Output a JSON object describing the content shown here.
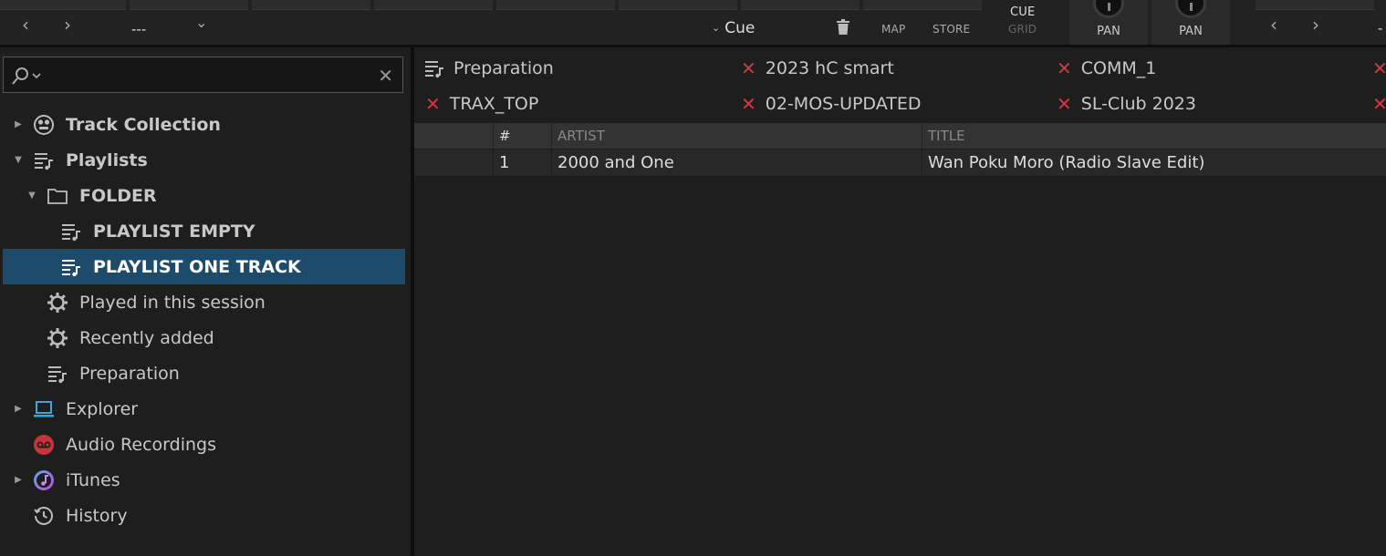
{
  "topbar": {
    "nav_prev": "‹",
    "nav_next": "›",
    "selector_value": "---",
    "selector_chevron": "⌄",
    "cue_chevron": "⌄",
    "cue_label": "Cue",
    "map_label": "MAP",
    "store_label": "STORE",
    "cue_grid_top": "CUE",
    "cue_grid_bottom": "GRID",
    "pan_left_label": "PAN",
    "pan_right_label": "PAN",
    "right_prev": "‹",
    "right_next": "›",
    "right_value": "-",
    "icons": {
      "delete": "trash-icon",
      "knob": "pan-knob"
    }
  },
  "search": {
    "placeholder": "",
    "value": "",
    "clear_label": "✕"
  },
  "sidebar": {
    "items": [
      {
        "label": "Track Collection",
        "icon": "track-collection-icon",
        "expand": "▶"
      },
      {
        "label": "Playlists",
        "icon": "playlists-icon",
        "expand": "▼"
      },
      {
        "label": "FOLDER",
        "icon": "folder-icon",
        "expand": "▼"
      },
      {
        "label": "PLAYLIST EMPTY",
        "icon": "playlist-icon"
      },
      {
        "label": "PLAYLIST ONE TRACK",
        "icon": "playlist-icon"
      },
      {
        "label": "Played in this session",
        "icon": "smart-playlist-gear-icon"
      },
      {
        "label": "Recently added",
        "icon": "smart-playlist-gear-icon"
      },
      {
        "label": "Preparation",
        "icon": "playlist-icon"
      },
      {
        "label": "Explorer",
        "icon": "explorer-laptop-icon",
        "expand": "▶"
      },
      {
        "label": "Audio Recordings",
        "icon": "audio-recordings-icon"
      },
      {
        "label": "iTunes",
        "icon": "itunes-icon",
        "expand": "▶"
      },
      {
        "label": "History",
        "icon": "history-clock-icon"
      }
    ],
    "selected_index": 4
  },
  "favorites": {
    "row1": [
      "Preparation",
      "2023 hC smart",
      "COMM_1"
    ],
    "row2": [
      "TRAX_TOP",
      "02-MOS-UPDATED",
      "SL-Club 2023"
    ],
    "remove_glyph": "✕"
  },
  "table": {
    "columns": [
      "",
      "#",
      "ARTIST",
      "TITLE"
    ],
    "rows": [
      {
        "num": "1",
        "artist": "2000 and One",
        "title": "Wan Poku Moro (Radio Slave Edit)"
      }
    ]
  },
  "colors": {
    "selected_bg": "#1d4b6b",
    "remove_x": "#d0393f",
    "panel_bg": "#1e1e1e",
    "header_bg": "#333333"
  }
}
